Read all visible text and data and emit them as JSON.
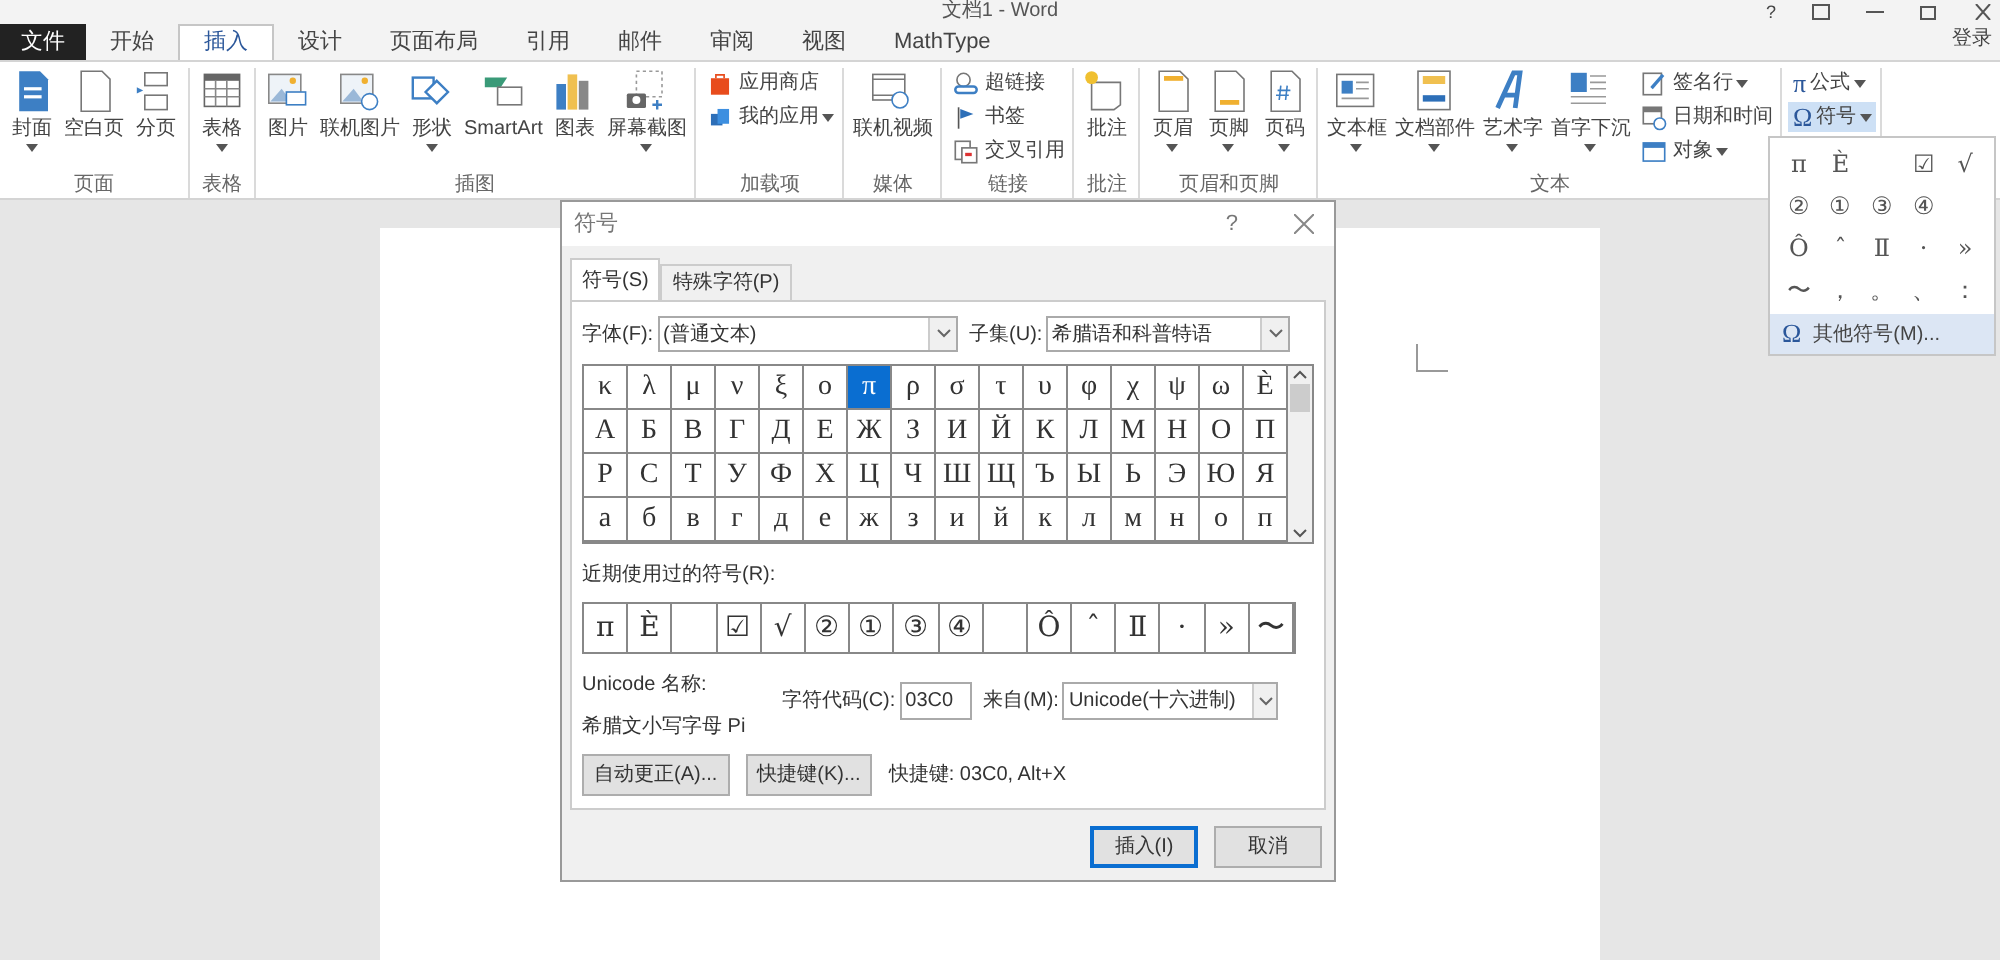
{
  "window": {
    "title": "文档1 - Word",
    "help": "?"
  },
  "account": "登录",
  "tabs": [
    {
      "label": "文件",
      "kind": "file",
      "selected": false
    },
    {
      "label": "开始",
      "kind": "tab",
      "selected": false
    },
    {
      "label": "插入",
      "kind": "tab",
      "selected": true
    },
    {
      "label": "设计",
      "kind": "tab",
      "selected": false
    },
    {
      "label": "页面布局",
      "kind": "tab",
      "selected": false
    },
    {
      "label": "引用",
      "kind": "tab",
      "selected": false
    },
    {
      "label": "邮件",
      "kind": "tab",
      "selected": false
    },
    {
      "label": "审阅",
      "kind": "tab",
      "selected": false
    },
    {
      "label": "视图",
      "kind": "tab",
      "selected": false
    },
    {
      "label": "MathType",
      "kind": "tab",
      "selected": false
    }
  ],
  "ribbon": {
    "groups": [
      {
        "label": "页面",
        "items": [
          {
            "label": "封面",
            "kind": "large",
            "dropdown": true
          },
          {
            "label": "空白页",
            "kind": "large",
            "dropdown": false
          },
          {
            "label": "分页",
            "kind": "large",
            "dropdown": false
          }
        ]
      },
      {
        "label": "表格",
        "items": [
          {
            "label": "表格",
            "kind": "large",
            "dropdown": true
          }
        ]
      },
      {
        "label": "插图",
        "items": [
          {
            "label": "图片",
            "kind": "large",
            "dropdown": false
          },
          {
            "label": "联机图片",
            "kind": "large",
            "dropdown": false
          },
          {
            "label": "形状",
            "kind": "large",
            "dropdown": true
          },
          {
            "label": "SmartArt",
            "kind": "large",
            "dropdown": false
          },
          {
            "label": "图表",
            "kind": "large",
            "dropdown": false
          },
          {
            "label": "屏幕截图",
            "kind": "large",
            "dropdown": true
          }
        ]
      },
      {
        "label": "加载项",
        "items": [
          {
            "label": "应用商店",
            "kind": "small",
            "dropdown": false
          },
          {
            "label": "我的应用",
            "kind": "small",
            "dropdown": true
          }
        ]
      },
      {
        "label": "媒体",
        "items": [
          {
            "label": "联机视频",
            "kind": "large",
            "dropdown": false
          }
        ]
      },
      {
        "label": "链接",
        "items": [
          {
            "label": "超链接",
            "kind": "small",
            "dropdown": false
          },
          {
            "label": "书签",
            "kind": "small",
            "dropdown": false
          },
          {
            "label": "交叉引用",
            "kind": "small",
            "dropdown": false
          }
        ]
      },
      {
        "label": "批注",
        "items": [
          {
            "label": "批注",
            "kind": "large",
            "dropdown": false
          }
        ]
      },
      {
        "label": "页眉和页脚",
        "items": [
          {
            "label": "页眉",
            "kind": "large",
            "dropdown": true
          },
          {
            "label": "页脚",
            "kind": "large",
            "dropdown": true
          },
          {
            "label": "页码",
            "kind": "large",
            "dropdown": true
          }
        ]
      },
      {
        "label": "文本",
        "items": [
          {
            "label": "文本框",
            "kind": "large",
            "dropdown": true
          },
          {
            "label": "文档部件",
            "kind": "large",
            "dropdown": true
          },
          {
            "label": "艺术字",
            "kind": "large",
            "dropdown": true
          },
          {
            "label": "首字下沉",
            "kind": "large",
            "dropdown": true
          },
          {
            "label": "签名行",
            "kind": "small",
            "dropdown": true
          },
          {
            "label": "日期和时间",
            "kind": "small",
            "dropdown": false
          },
          {
            "label": "对象",
            "kind": "small",
            "dropdown": true
          }
        ]
      },
      {
        "items": [
          {
            "label": "公式",
            "kind": "char",
            "icon_char": "π",
            "dropdown": true,
            "pressed": false
          },
          {
            "label": "符号",
            "kind": "char",
            "icon_char": "Ω",
            "dropdown": true,
            "pressed": true
          }
        ]
      }
    ]
  },
  "symbol_menu": {
    "symbols": [
      {
        "kind": "glyph",
        "char": "π"
      },
      {
        "kind": "glyph",
        "char": "Ѐ"
      },
      {
        "kind": "blank"
      },
      {
        "kind": "glyph",
        "char": "☑"
      },
      {
        "kind": "glyph",
        "char": "√"
      },
      {
        "kind": "glyph",
        "char": "②"
      },
      {
        "kind": "glyph",
        "char": "①"
      },
      {
        "kind": "glyph",
        "char": "③"
      },
      {
        "kind": "glyph",
        "char": "④"
      },
      {
        "kind": "blank"
      },
      {
        "kind": "glyph",
        "char": "Ô"
      },
      {
        "kind": "glyph",
        "char": "ˆ"
      },
      {
        "kind": "glyph",
        "char": "Ⅱ"
      },
      {
        "kind": "glyph",
        "char": "·"
      },
      {
        "kind": "glyph",
        "char": "»"
      },
      {
        "kind": "glyph",
        "char": "〜"
      },
      {
        "kind": "glyph",
        "char": "，"
      },
      {
        "kind": "glyph",
        "char": "。"
      },
      {
        "kind": "glyph",
        "char": "、"
      },
      {
        "kind": "glyph",
        "char": "："
      }
    ],
    "more_icon": "Ω",
    "more": "其他符号(M)..."
  },
  "dialog": {
    "title": "符号",
    "help": "?",
    "tabs": [
      {
        "label": "符号(S)",
        "selected": true
      },
      {
        "label": "特殊字符(P)",
        "selected": false
      }
    ],
    "font_label": "字体(F):",
    "font": "(普通文本)",
    "subset_label": "子集(U):",
    "subset": "希腊语和科普特语",
    "grid": [
      [
        {
          "char": "κ",
          "selected": false
        },
        {
          "char": "λ",
          "selected": false
        },
        {
          "char": "μ",
          "selected": false
        },
        {
          "char": "ν",
          "selected": false
        },
        {
          "char": "ξ",
          "selected": false
        },
        {
          "char": "ο",
          "selected": false
        },
        {
          "char": "π",
          "selected": true
        },
        {
          "char": "ρ",
          "selected": false
        },
        {
          "char": "σ",
          "selected": false
        },
        {
          "char": "τ",
          "selected": false
        },
        {
          "char": "υ",
          "selected": false
        },
        {
          "char": "φ",
          "selected": false
        },
        {
          "char": "χ",
          "selected": false
        },
        {
          "char": "ψ",
          "selected": false
        },
        {
          "char": "ω",
          "selected": false
        },
        {
          "char": "Ѐ",
          "selected": false
        }
      ],
      [
        {
          "char": "А",
          "selected": false
        },
        {
          "char": "Б",
          "selected": false
        },
        {
          "char": "В",
          "selected": false
        },
        {
          "char": "Г",
          "selected": false
        },
        {
          "char": "Д",
          "selected": false
        },
        {
          "char": "Е",
          "selected": false
        },
        {
          "char": "Ж",
          "selected": false
        },
        {
          "char": "З",
          "selected": false
        },
        {
          "char": "И",
          "selected": false
        },
        {
          "char": "Й",
          "selected": false
        },
        {
          "char": "К",
          "selected": false
        },
        {
          "char": "Л",
          "selected": false
        },
        {
          "char": "М",
          "selected": false
        },
        {
          "char": "Н",
          "selected": false
        },
        {
          "char": "О",
          "selected": false
        },
        {
          "char": "П",
          "selected": false
        }
      ],
      [
        {
          "char": "Р",
          "selected": false
        },
        {
          "char": "С",
          "selected": false
        },
        {
          "char": "Т",
          "selected": false
        },
        {
          "char": "У",
          "selected": false
        },
        {
          "char": "Ф",
          "selected": false
        },
        {
          "char": "Х",
          "selected": false
        },
        {
          "char": "Ц",
          "selected": false
        },
        {
          "char": "Ч",
          "selected": false
        },
        {
          "char": "Ш",
          "selected": false
        },
        {
          "char": "Щ",
          "selected": false
        },
        {
          "char": "Ъ",
          "selected": false
        },
        {
          "char": "Ы",
          "selected": false
        },
        {
          "char": "Ь",
          "selected": false
        },
        {
          "char": "Э",
          "selected": false
        },
        {
          "char": "Ю",
          "selected": false
        },
        {
          "char": "Я",
          "selected": false
        }
      ],
      [
        {
          "char": "а",
          "selected": false
        },
        {
          "char": "б",
          "selected": false
        },
        {
          "char": "в",
          "selected": false
        },
        {
          "char": "г",
          "selected": false
        },
        {
          "char": "д",
          "selected": false
        },
        {
          "char": "е",
          "selected": false
        },
        {
          "char": "ж",
          "selected": false
        },
        {
          "char": "з",
          "selected": false
        },
        {
          "char": "и",
          "selected": false
        },
        {
          "char": "й",
          "selected": false
        },
        {
          "char": "к",
          "selected": false
        },
        {
          "char": "л",
          "selected": false
        },
        {
          "char": "м",
          "selected": false
        },
        {
          "char": "н",
          "selected": false
        },
        {
          "char": "о",
          "selected": false
        },
        {
          "char": "п",
          "selected": false
        }
      ]
    ],
    "recent_label": "近期使用过的符号(R):",
    "recent": [
      {
        "kind": "glyph",
        "char": "π"
      },
      {
        "kind": "glyph",
        "char": "Ѐ"
      },
      {
        "kind": "blank"
      },
      {
        "kind": "glyph",
        "char": "☑"
      },
      {
        "kind": "glyph",
        "char": "√"
      },
      {
        "kind": "glyph",
        "char": "②"
      },
      {
        "kind": "glyph",
        "char": "①"
      },
      {
        "kind": "glyph",
        "char": "③"
      },
      {
        "kind": "glyph",
        "char": "④"
      },
      {
        "kind": "blank"
      },
      {
        "kind": "glyph",
        "char": "Ô"
      },
      {
        "kind": "glyph",
        "char": "ˆ"
      },
      {
        "kind": "glyph",
        "char": "Ⅱ"
      },
      {
        "kind": "glyph",
        "char": "·"
      },
      {
        "kind": "glyph",
        "char": "»"
      },
      {
        "kind": "glyph",
        "char": "〜"
      }
    ],
    "unicode_label": "Unicode 名称:",
    "unicode_name": "希腊文小写字母 Pi",
    "code_label": "字符代码(C):",
    "code": "03C0",
    "from_label": "来自(M):",
    "from": "Unicode(十六进制)",
    "autocorrect": "自动更正(A)...",
    "shortcut_button": "快捷键(K)...",
    "shortcut_text": "快捷键: 03C0, Alt+X",
    "insert": "插入(I)",
    "cancel": "取消"
  }
}
